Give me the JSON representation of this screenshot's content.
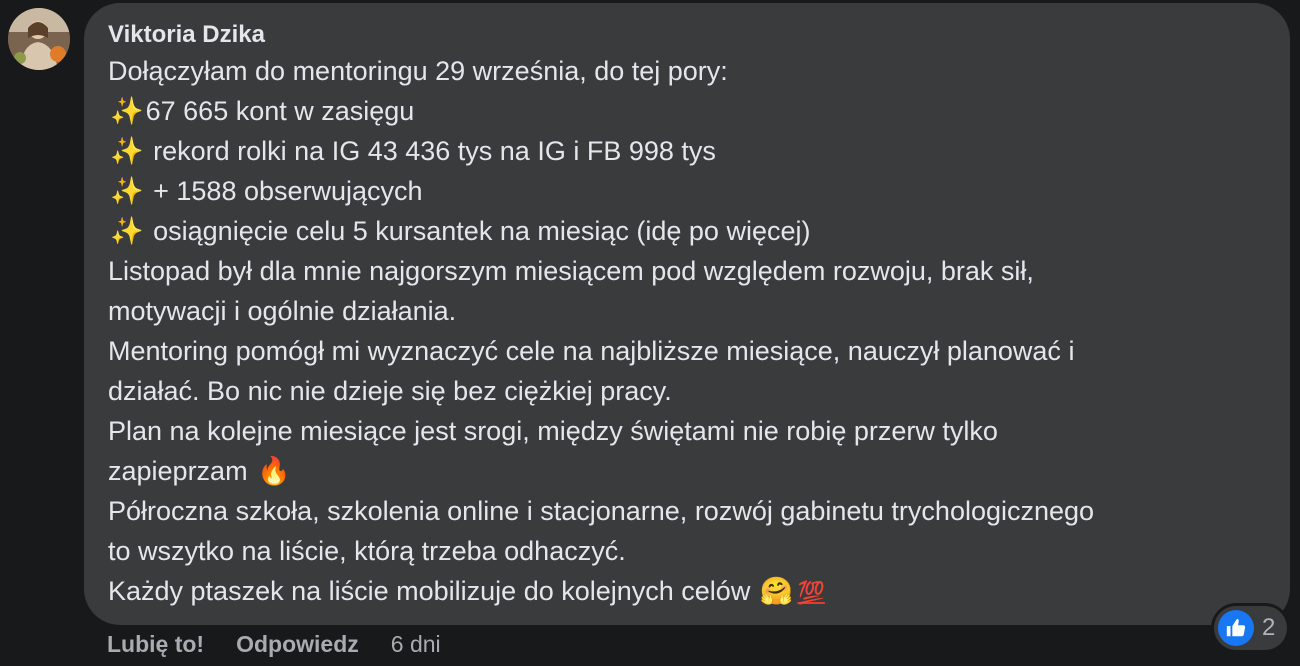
{
  "comment": {
    "author": "Viktoria Dzika",
    "lines": [
      {
        "emoji": "",
        "text": "Dołączyłam do mentoringu 29 września, do tej pory:"
      },
      {
        "emoji": "✨",
        "text": "67 665 kont w zasięgu"
      },
      {
        "emoji": "✨",
        "text": " rekord rolki na IG 43 436 tys na IG i FB 998 tys"
      },
      {
        "emoji": "✨",
        "text": " + 1588 obserwujących"
      },
      {
        "emoji": "✨",
        "text": " osiągnięcie celu 5 kursantek na miesiąc (idę po więcej)"
      },
      {
        "emoji": "",
        "text": "Listopad był dla mnie najgorszym miesiącem pod względem rozwoju, brak sił,"
      },
      {
        "emoji": "",
        "text": "motywacji i ogólnie działania."
      },
      {
        "emoji": "",
        "text": "Mentoring pomógł mi wyznaczyć cele na najbliższe miesiące, nauczył planować i"
      },
      {
        "emoji": "",
        "text": "działać. Bo nic nie dzieje się bez ciężkiej pracy."
      },
      {
        "emoji": "",
        "text": "Plan na kolejne miesiące jest srogi, między świętami nie robię przerw tylko"
      },
      {
        "emoji": "",
        "text": "zapieprzam "
      },
      {
        "emoji": "",
        "text": "Półroczna szkoła, szkolenia online i stacjonarne, rozwój gabinetu trychologicznego"
      },
      {
        "emoji": "",
        "text": "to wszytko na liście, którą trzeba odhaczyć."
      },
      {
        "emoji": "",
        "text": "Każdy ptaszek na liście mobilizuje do kolejnych celów "
      }
    ],
    "fire_emoji": "🔥",
    "hug_emoji": "🤗",
    "hundred_emoji": "💯"
  },
  "actions": {
    "like_label": "Lubię to!",
    "reply_label": "Odpowiedz",
    "time": "6 dni"
  },
  "reactions": {
    "icon": "thumbs-up-icon",
    "count": "2",
    "badge_color": "#1877f2"
  }
}
